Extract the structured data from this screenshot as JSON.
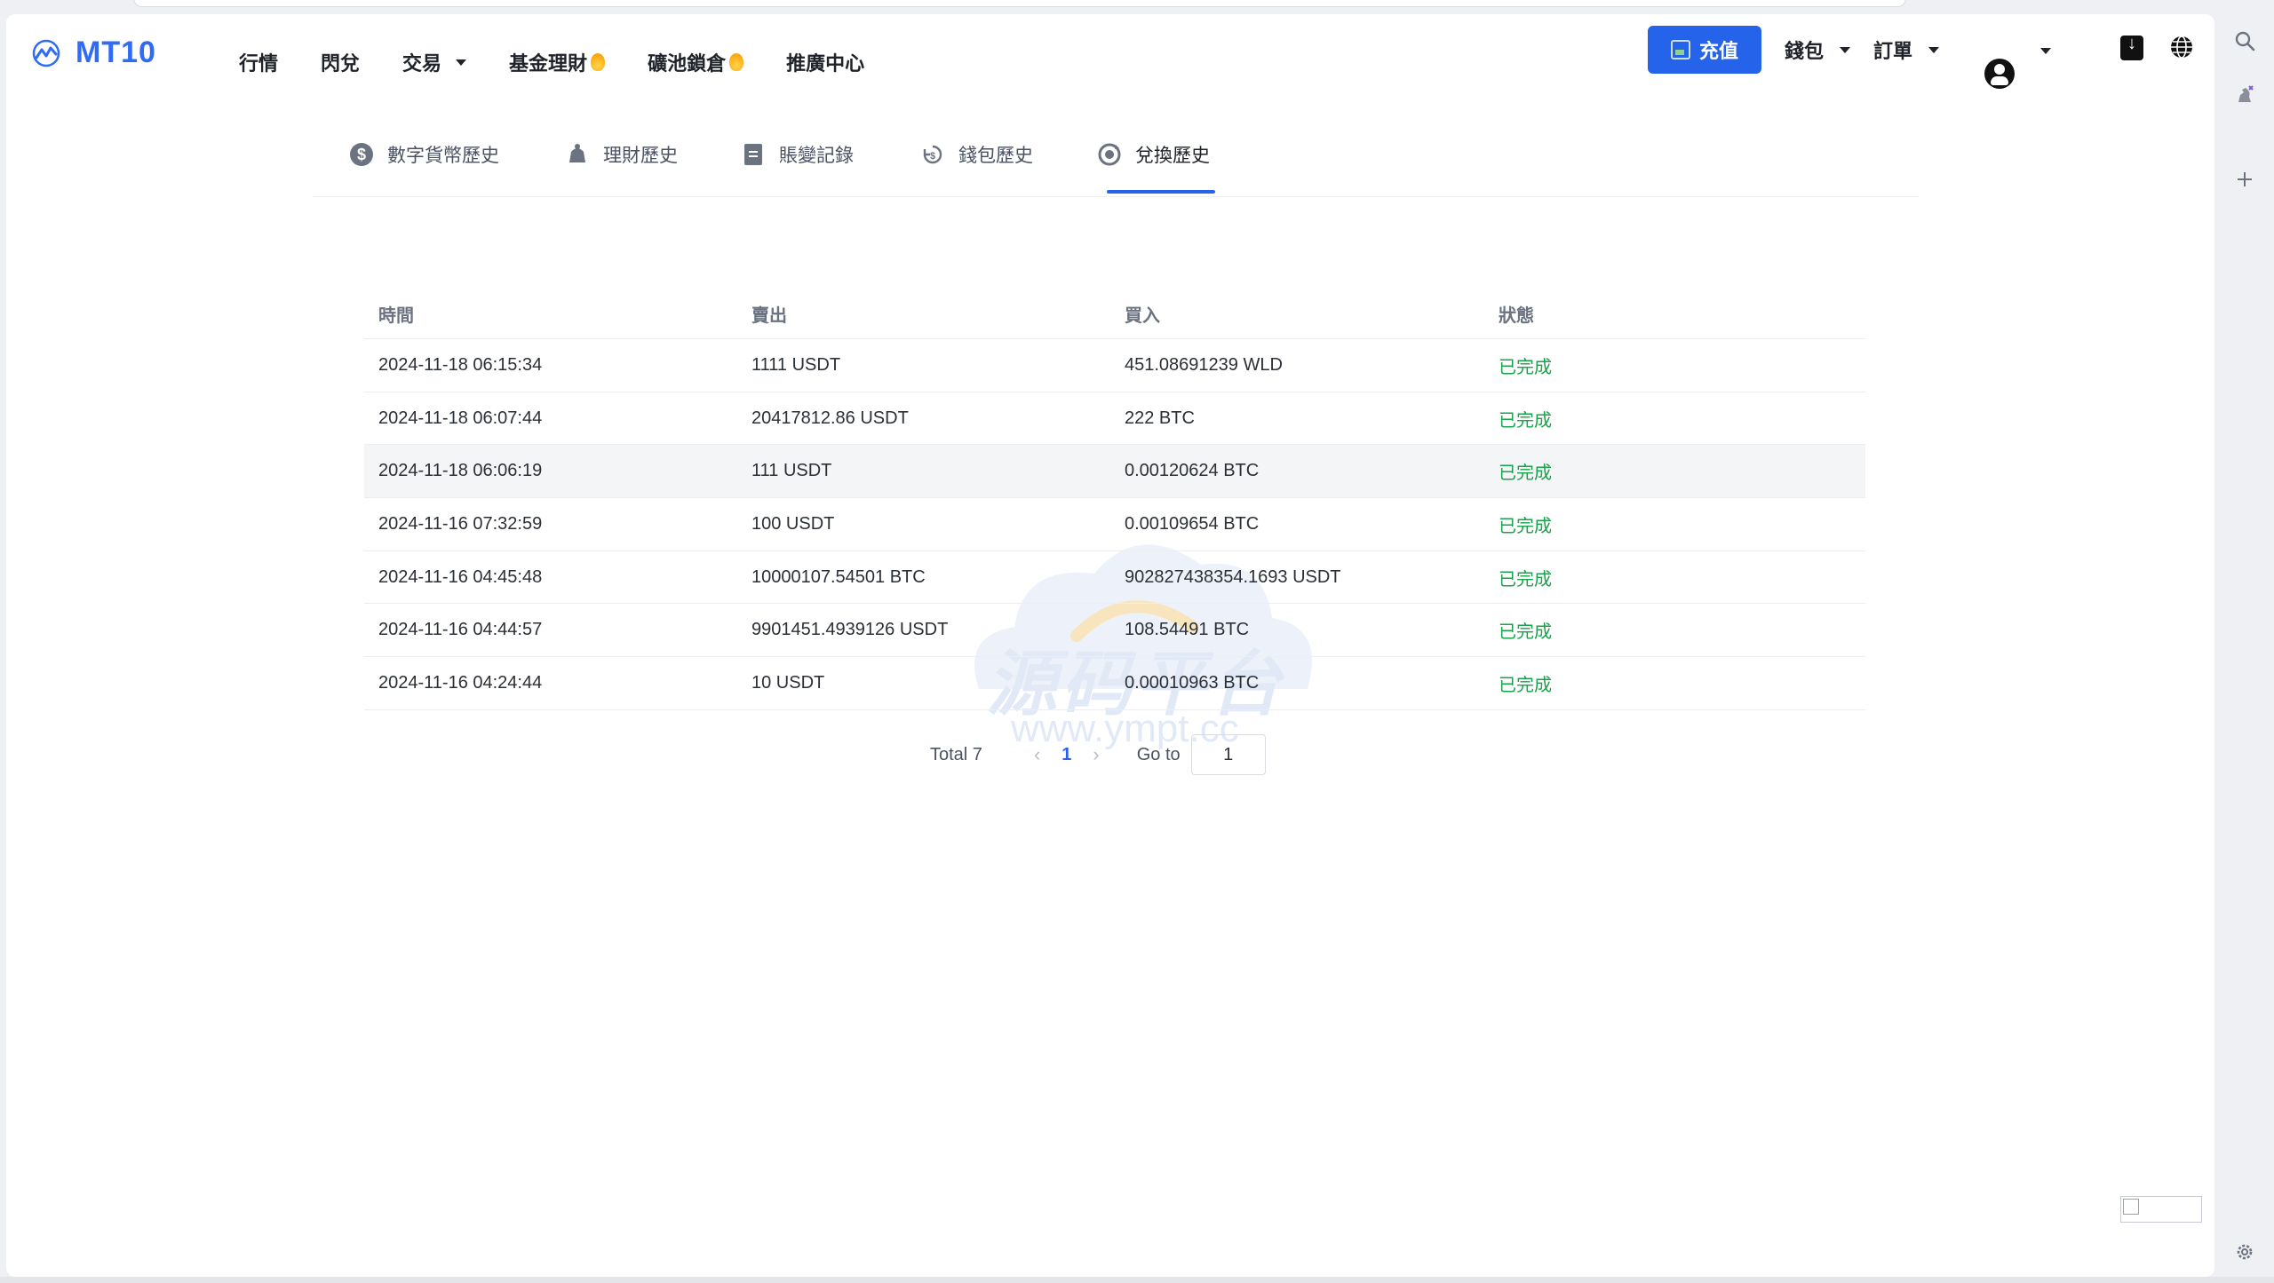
{
  "nav": {
    "brand": "MT10",
    "menu": [
      {
        "label": "行情",
        "has_caret": false,
        "hot": false
      },
      {
        "label": "閃兌",
        "has_caret": false,
        "hot": false
      },
      {
        "label": "交易",
        "has_caret": true,
        "hot": false
      },
      {
        "label": "基金理財",
        "has_caret": false,
        "hot": true
      },
      {
        "label": "礦池鎖倉",
        "has_caret": false,
        "hot": true
      },
      {
        "label": "推廣中心",
        "has_caret": false,
        "hot": false
      }
    ],
    "recharge_label": "充值",
    "wallet_label": "錢包",
    "orders_label": "訂單"
  },
  "tabs": [
    {
      "label": "數字貨幣歷史",
      "icon": "dollar-circle-icon",
      "active": false
    },
    {
      "label": "理財歷史",
      "icon": "piggy-bank-icon",
      "active": false
    },
    {
      "label": "賬變記錄",
      "icon": "document-icon",
      "active": false
    },
    {
      "label": "錢包歷史",
      "icon": "wallet-history-icon",
      "active": false
    },
    {
      "label": "兌換歷史",
      "icon": "exchange-icon",
      "active": true
    }
  ],
  "table": {
    "headers": [
      "時間",
      "賣出",
      "買入",
      "狀態"
    ],
    "rows": [
      {
        "time": "2024-11-18 06:15:34",
        "sell": "1111 USDT",
        "buy": "451.08691239 WLD",
        "status": "已完成"
      },
      {
        "time": "2024-11-18 06:07:44",
        "sell": "20417812.86 USDT",
        "buy": "222 BTC",
        "status": "已完成"
      },
      {
        "time": "2024-11-18 06:06:19",
        "sell": "111 USDT",
        "buy": "0.00120624 BTC",
        "status": "已完成"
      },
      {
        "time": "2024-11-16 07:32:59",
        "sell": "100 USDT",
        "buy": "0.00109654 BTC",
        "status": "已完成"
      },
      {
        "time": "2024-11-16 04:45:48",
        "sell": "10000107.54501 BTC",
        "buy": "902827438354.1693 USDT",
        "status": "已完成"
      },
      {
        "time": "2024-11-16 04:44:57",
        "sell": "9901451.4939126 USDT",
        "buy": "108.54491 BTC",
        "status": "已完成"
      },
      {
        "time": "2024-11-16 04:24:44",
        "sell": "10 USDT",
        "buy": "0.00010963 BTC",
        "status": "已完成"
      }
    ]
  },
  "pagination": {
    "total_label": "Total 7",
    "current_page": "1",
    "goto_label": "Go to",
    "goto_value": "1"
  },
  "watermark": {
    "text": "源码平台",
    "url": "www.ympt.cc"
  },
  "colors": {
    "accent": "#2563eb",
    "status_done": "#16a34a"
  }
}
